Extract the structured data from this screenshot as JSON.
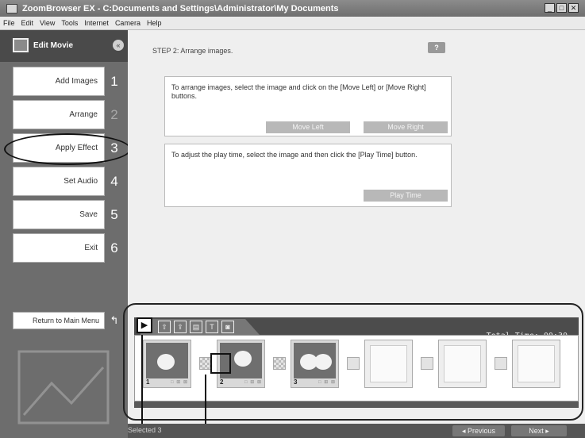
{
  "window": {
    "title": "ZoomBrowser EX  -  C:Documents and Settings\\Administrator\\My Documents",
    "controls": [
      "_",
      "□",
      "✕"
    ]
  },
  "menu": [
    "File",
    "Edit",
    "View",
    "Tools",
    "Internet",
    "Camera",
    "Help"
  ],
  "sidebar": {
    "title": "Edit Movie",
    "collapse_glyph": "«",
    "steps": [
      {
        "label": "Add Images",
        "number": "1"
      },
      {
        "label": "Arrange",
        "number": "2"
      },
      {
        "label": "Apply Effect",
        "number": "3"
      },
      {
        "label": "Set Audio",
        "number": "4"
      },
      {
        "label": "Save",
        "number": "5"
      },
      {
        "label": "Exit",
        "number": "6"
      }
    ],
    "return_label": "Return to Main Menu",
    "return_glyph": "↰"
  },
  "main": {
    "step_label": "STEP 2: Arrange images.",
    "help_label": "?",
    "arrange_instructions": "To arrange images, select the image and click on the [Move Left] or [Move Right] buttons.",
    "move_left_label": "Move Left",
    "move_right_label": "Move Right",
    "playtime_instructions": "To adjust the play time, select the image and then click the [Play Time] button.",
    "play_time_label": "Play Time"
  },
  "timeline": {
    "total_time_label": "Total Time:  00:30",
    "play_glyph": "▶",
    "tool_icons": [
      "⇧",
      "⇪",
      "▤",
      "T",
      "◙"
    ],
    "frames": [
      {
        "number": "1",
        "mini": "□ ⊞ ⊠"
      },
      {
        "number": "2",
        "mini": "□ ⊞ ⊠"
      },
      {
        "number": "3",
        "mini": "□ ⊞ ⊠"
      }
    ]
  },
  "status": {
    "selected": "Selected  3",
    "previous_label": "◂ Previous",
    "next_label": "Next  ▸"
  }
}
